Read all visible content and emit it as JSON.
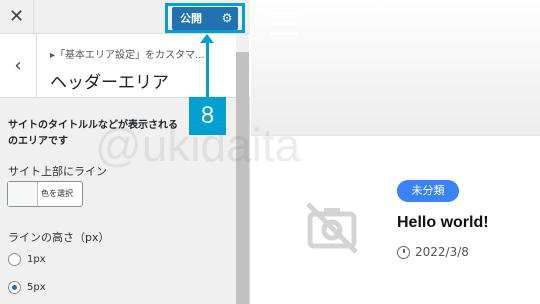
{
  "topbar": {
    "close_glyph": "✕",
    "publish_label": "公開",
    "gear_icon": "gear-icon"
  },
  "section": {
    "breadcrumb": "▸「基本エリア設定」をカスタマ...",
    "title": "ヘッダーエリア"
  },
  "settings": {
    "description": "サイトのタイトルルなどが表示される\nのエリアです",
    "top_line_label": "サイト上部にライン",
    "color_button_label": "色を選択",
    "line_height_label": "ラインの高さ（px）",
    "options": [
      {
        "label": "1px",
        "checked": false
      },
      {
        "label": "5px",
        "checked": true
      }
    ]
  },
  "callout": {
    "number": "8"
  },
  "preview": {
    "category": "未分類",
    "post_title": "Hello world!",
    "post_date": "2022/3/8"
  },
  "watermark": "@ukidaita",
  "colors": {
    "accent": "#2271b1",
    "callout": "#00a0d2",
    "badge": "#3b82f6"
  }
}
